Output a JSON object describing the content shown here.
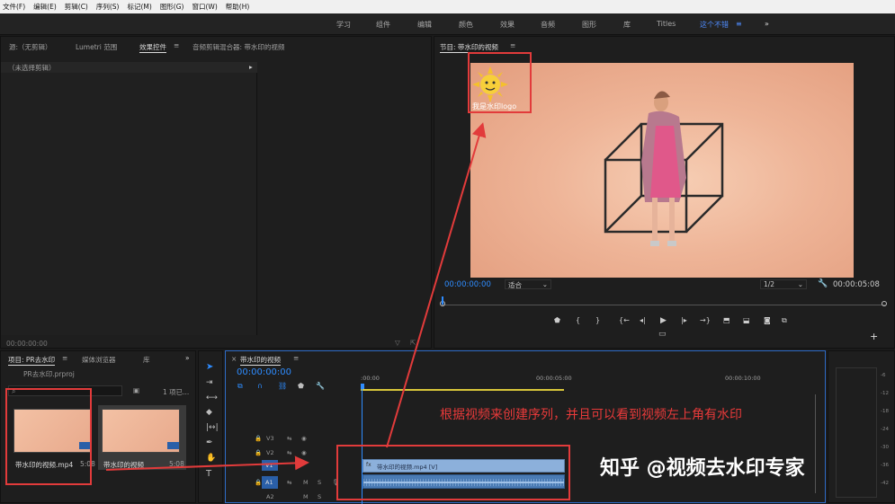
{
  "menu": [
    "文件(F)",
    "编辑(E)",
    "剪辑(C)",
    "序列(S)",
    "标记(M)",
    "图形(G)",
    "窗口(W)",
    "帮助(H)"
  ],
  "workspaces": [
    "学习",
    "组件",
    "编辑",
    "颜色",
    "效果",
    "音频",
    "图形",
    "库",
    "Titles",
    "这个不错"
  ],
  "source_panel": {
    "tabs": [
      "源:（无剪辑）",
      "Lumetri 范围",
      "效果控件",
      "音频剪辑混合器: 带水印的视频"
    ],
    "no_clip": "（未选择剪辑）",
    "timecode": "00:00:00:00"
  },
  "program": {
    "title": "节目: 带水印的视频",
    "timecode": "00:00:00:00",
    "fit": "适合",
    "quality": "1/2",
    "duration": "00:00:05:08",
    "watermark_text": "我是水印logo"
  },
  "project": {
    "tabs": [
      "项目: PR去水印",
      "媒体浏览器",
      "库"
    ],
    "file": "PR去水印.prproj",
    "items_label": "1 项已...",
    "clip1": "带水印的视频.mp4",
    "clip1_dur": "5:08",
    "clip2": "带水印的视频",
    "clip2_dur": "5:08"
  },
  "timeline": {
    "tab": "带水印的视频",
    "timecode": "00:00:00:00",
    "ruler": [
      ":00:00",
      "00:00:05:00",
      "00:00:10:00"
    ],
    "tracks": [
      "V3",
      "V2",
      "V1",
      "A1",
      "A2"
    ],
    "clip_label": "带水印的视频.mp4 [V]"
  },
  "annotation": "根据视频来创建序列，并且可以看到视频左上角有水印",
  "signature": "知乎 @视频去水印专家"
}
